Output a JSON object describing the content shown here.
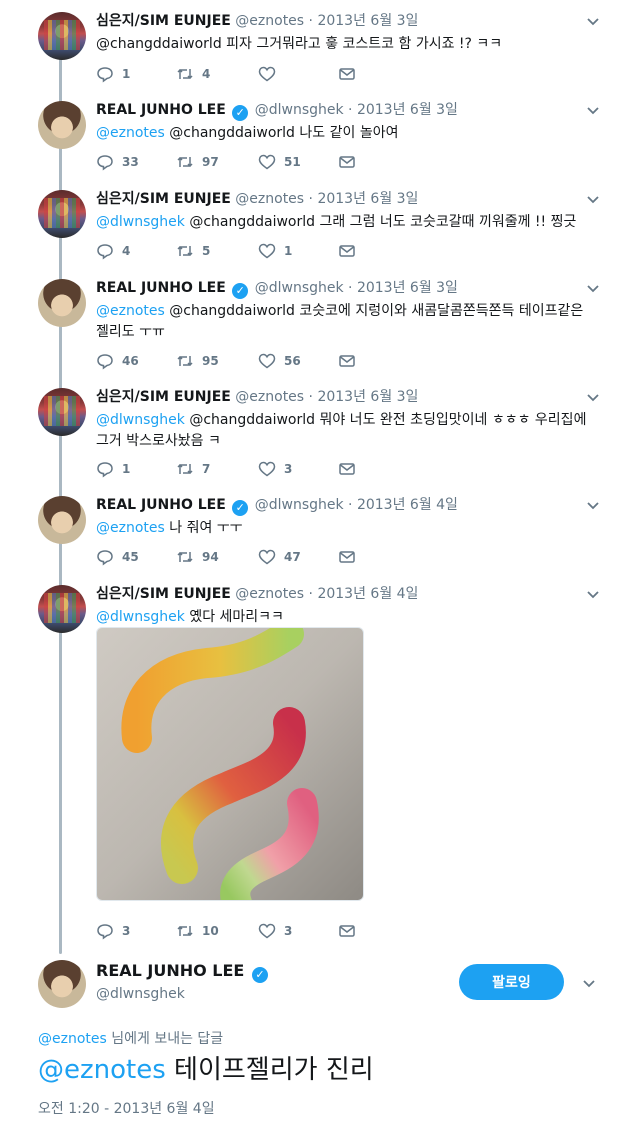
{
  "tweets": [
    {
      "name": "심은지/SIM EUNJEE",
      "handle": "@eznotes",
      "dot": "·",
      "date": "2013년 6월 3일",
      "mention": "",
      "text": "@changddaiworld 피자 그거뭐라고 흫 코스트코 함 가시죠 !? ㅋㅋ",
      "replies": "1",
      "retweets": "4",
      "likes": ""
    },
    {
      "name": "REAL JUNHO LEE",
      "handle": "@dlwnsghek",
      "dot": "·",
      "date": "2013년 6월 3일",
      "mention": "@eznotes",
      "text": " @changddaiworld 나도 같이 놀아여",
      "replies": "33",
      "retweets": "97",
      "likes": "51"
    },
    {
      "name": "심은지/SIM EUNJEE",
      "handle": "@eznotes",
      "dot": "·",
      "date": "2013년 6월 3일",
      "mention": "@dlwnsghek",
      "text": " @changddaiworld 그래 그럼 너도 코슷코갈때 끼워줄께 !! 찡긋",
      "replies": "4",
      "retweets": "5",
      "likes": "1"
    },
    {
      "name": "REAL JUNHO LEE",
      "handle": "@dlwnsghek",
      "dot": "·",
      "date": "2013년 6월 3일",
      "mention": "@eznotes",
      "text": " @changddaiworld 코슷코에 지렁이와 새콤달콤쫀득쫀득 테이프같은 젤리도 ㅜㅠ",
      "replies": "46",
      "retweets": "95",
      "likes": "56"
    },
    {
      "name": "심은지/SIM EUNJEE",
      "handle": "@eznotes",
      "dot": "·",
      "date": "2013년 6월 3일",
      "mention": "@dlwnsghek",
      "text": " @changddaiworld 뭐야 너도 완전 초딩입맛이네 ㅎㅎㅎ 우리집에 그거 박스로사놨음 ㅋ",
      "replies": "1",
      "retweets": "7",
      "likes": "3"
    },
    {
      "name": "REAL JUNHO LEE",
      "handle": "@dlwnsghek",
      "dot": "·",
      "date": "2013년 6월 4일",
      "mention": "@eznotes",
      "text": " 나 줘여 ㅜㅜ",
      "replies": "45",
      "retweets": "94",
      "likes": "47"
    },
    {
      "name": "심은지/SIM EUNJEE",
      "handle": "@eznotes",
      "dot": "·",
      "date": "2013년 6월 4일",
      "mention": "@dlwnsghek",
      "text": " 옜다 세마리ㅋㅋ",
      "replies": "3",
      "retweets": "10",
      "likes": "3"
    }
  ],
  "main_tweet": {
    "name": "REAL JUNHO LEE",
    "handle": "@dlwnsghek",
    "follow_label": "팔로잉",
    "reply_mention": "@eznotes",
    "reply_suffix": " 님에게 보내는 답글",
    "mention": "@eznotes",
    "text": " 테이프젤리가 진리",
    "time": "오전 1:20 - 2013년 6월 4일"
  },
  "icons": [
    "reply-icon",
    "retweet-icon",
    "like-icon",
    "message-icon",
    "chevron-down-icon",
    "verified-icon"
  ],
  "colors": {
    "accent": "#1da1f2",
    "muted": "#657786",
    "thread": "#aab8c2"
  }
}
